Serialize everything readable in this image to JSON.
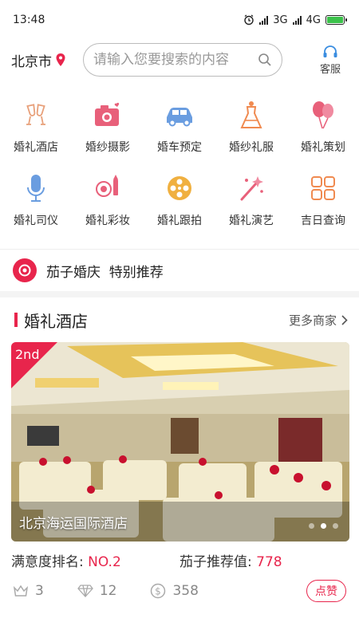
{
  "status_bar": {
    "time": "13:48",
    "net1": "3G",
    "net2": "4G"
  },
  "header": {
    "city": "北京市",
    "search_placeholder": "请输入您要搜索的内容",
    "service_label": "客服"
  },
  "categories": [
    {
      "label": "婚礼酒店",
      "icon": "champagne-icon",
      "color": "#e8a07a"
    },
    {
      "label": "婚纱摄影",
      "icon": "camera-icon",
      "color": "#e8607a"
    },
    {
      "label": "婚车预定",
      "icon": "car-icon",
      "color": "#6a9de0"
    },
    {
      "label": "婚纱礼服",
      "icon": "dress-icon",
      "color": "#f08a50"
    },
    {
      "label": "婚礼策划",
      "icon": "balloons-icon",
      "color": "#e8607a"
    },
    {
      "label": "婚礼司仪",
      "icon": "microphone-icon",
      "color": "#6a9de0"
    },
    {
      "label": "婚礼彩妆",
      "icon": "cosmetics-icon",
      "color": "#e8607a"
    },
    {
      "label": "婚礼跟拍",
      "icon": "film-reel-icon",
      "color": "#f0b040"
    },
    {
      "label": "婚礼演艺",
      "icon": "magic-wand-icon",
      "color": "#e8607a"
    },
    {
      "label": "吉日查询",
      "icon": "grid-icon",
      "color": "#f08a50"
    }
  ],
  "promo": {
    "text": "茄子婚庆  特别推荐"
  },
  "section": {
    "title": "婚礼酒店",
    "more": "更多商家"
  },
  "hotel": {
    "rank_badge": "2nd",
    "name": "北京海运国际酒店",
    "rank_label": "满意度排名:",
    "rank_value": "NO.2",
    "score_label": "茄子推荐值:",
    "score_value": "778",
    "crowns": "3",
    "diamonds": "12",
    "coins": "358",
    "like_label": "点赞"
  },
  "colors": {
    "accent": "#e8254c"
  }
}
